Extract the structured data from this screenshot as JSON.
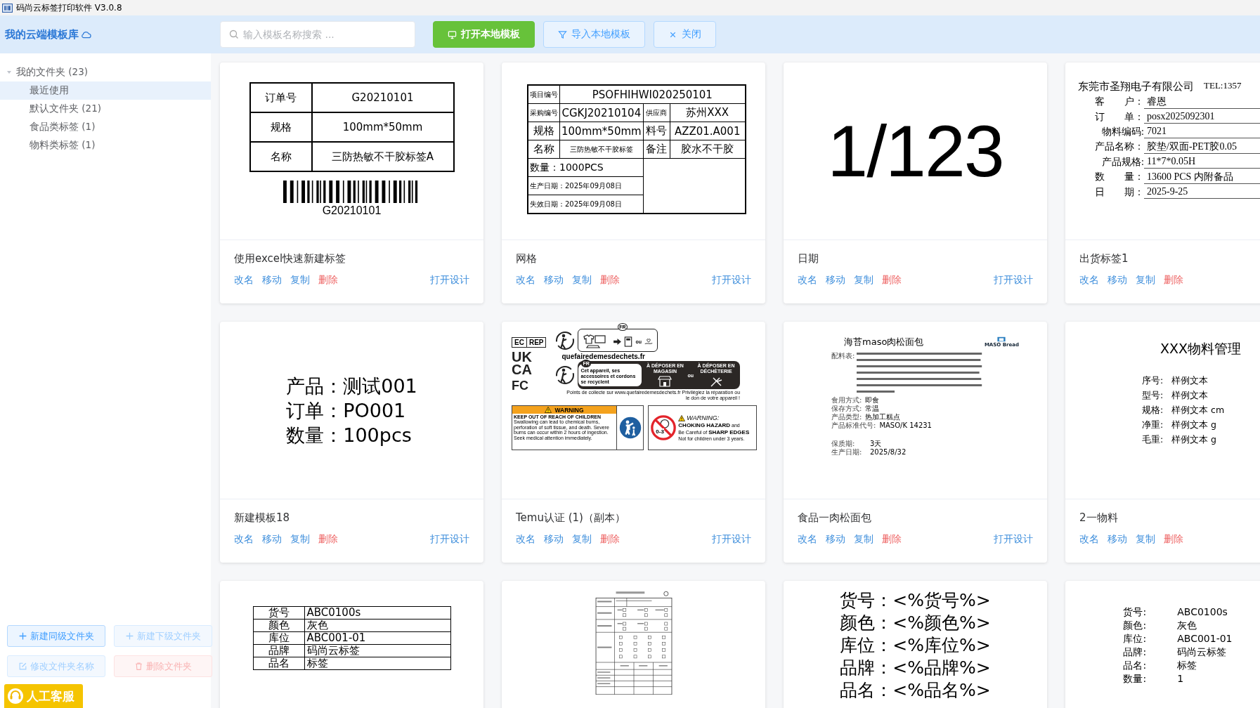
{
  "window": {
    "title": "码尚云标签打印软件 V3.0.8"
  },
  "library": {
    "title": "我的云端模板库"
  },
  "search": {
    "placeholder": "输入模板名称搜索 ..."
  },
  "toolbar": [
    {
      "label": "打开本地模板",
      "kind": "primary"
    },
    {
      "label": "导入本地模板",
      "kind": "plain"
    },
    {
      "label": "关闭",
      "kind": "plain"
    }
  ],
  "folders": [
    {
      "label": "我的文件夹 (23)",
      "expanded": true,
      "selected": false,
      "children": [
        {
          "label": "最近使用",
          "selected": true
        },
        {
          "label": "默认文件夹 (21)",
          "selected": false
        },
        {
          "label": "食品类标签 (1)",
          "selected": false
        },
        {
          "label": "物料类标签 (1)",
          "selected": false
        }
      ]
    }
  ],
  "sidebar_buttons": [
    {
      "label": "新建同级文件夹",
      "kind": "normal",
      "disabled": false
    },
    {
      "label": "新建下级文件夹",
      "kind": "normal",
      "disabled": true
    },
    {
      "label": "修改文件夹名称",
      "kind": "normal",
      "disabled": true
    },
    {
      "label": "删除文件夹",
      "kind": "danger",
      "disabled": true
    }
  ],
  "support": {
    "label": "人工客服"
  },
  "cards": [
    {
      "name": "使用excel快速新建标签",
      "open": "打开设计",
      "actions": [
        {
          "label": "改名",
          "kind": "normal"
        },
        {
          "label": "移动",
          "kind": "normal"
        },
        {
          "label": "复制",
          "kind": "normal"
        },
        {
          "label": "删除",
          "kind": "danger"
        }
      ],
      "preview": {
        "kind": "table",
        "rows": [
          [
            "订单号",
            "G20210101"
          ],
          [
            "规格",
            "100mm*50mm"
          ],
          [
            "名称",
            "三防热敏不干胶标签A"
          ]
        ],
        "barcode": "G20210101"
      }
    },
    {
      "name": "网格",
      "open": "打开设计",
      "actions": [
        {
          "label": "改名",
          "kind": "normal"
        },
        {
          "label": "移动",
          "kind": "normal"
        },
        {
          "label": "复制",
          "kind": "normal"
        },
        {
          "label": "删除",
          "kind": "danger"
        }
      ],
      "preview": {
        "kind": "grid",
        "rows": [
          [
            {
              "text": "项目编号"
            },
            {
              "text": "PSOFHIHWI020250101",
              "colspan": 3
            }
          ],
          [
            {
              "text": "采购编号"
            },
            {
              "text": "CGKJ20210104"
            },
            {
              "text": "供应商"
            },
            {
              "text": "苏州XXX"
            }
          ],
          [
            {
              "text": "规格"
            },
            {
              "text": "100mm*50mm"
            },
            {
              "text": "料号"
            },
            {
              "text": "AZZ01.A001"
            }
          ],
          [
            {
              "text": "名称"
            },
            {
              "text": "三防热敏不干胶标签"
            },
            {
              "text": "备注"
            },
            {
              "text": "胶水不干胶"
            }
          ]
        ],
        "lower": [
          "数量：1000PCS",
          "生产日期：2025年09月08日",
          "失效日期：2025年09月08日"
        ]
      }
    },
    {
      "name": "日期",
      "open": "打开设计",
      "actions": [
        {
          "label": "改名",
          "kind": "normal"
        },
        {
          "label": "移动",
          "kind": "normal"
        },
        {
          "label": "复制",
          "kind": "normal"
        },
        {
          "label": "删除",
          "kind": "danger"
        }
      ],
      "preview": {
        "kind": "big",
        "text": "1/123"
      }
    },
    {
      "name": "出货标签1",
      "actions": [
        {
          "label": "改名",
          "kind": "normal"
        },
        {
          "label": "移动",
          "kind": "normal"
        },
        {
          "label": "复制",
          "kind": "normal"
        },
        {
          "label": "删除",
          "kind": "danger"
        }
      ],
      "preview": {
        "kind": "form",
        "title": "东莞市圣翔电子有限公司",
        "tel": "TEL:1357",
        "fields": [
          [
            "客　　户：",
            "睿恩"
          ],
          [
            "订　　单：",
            "posx2025092301"
          ],
          [
            "物料编码:",
            "7021"
          ],
          [
            "产品名称：",
            "胶垫/双面-PET胶0.05"
          ],
          [
            "产品规格:",
            "11*7*0.05H"
          ],
          [
            "数　　量：",
            "13600 PCS 内附备品"
          ],
          [
            "日　　期：",
            "2025-9-25"
          ]
        ]
      }
    },
    {
      "name": "新建模板18",
      "open": "打开设计",
      "actions": [
        {
          "label": "改名",
          "kind": "normal"
        },
        {
          "label": "移动",
          "kind": "normal"
        },
        {
          "label": "复制",
          "kind": "normal"
        },
        {
          "label": "删除",
          "kind": "danger"
        }
      ],
      "preview": {
        "kind": "lines",
        "text": [
          "产品：测试001",
          "订单：PO001",
          "数量：100pcs"
        ]
      }
    },
    {
      "name": "Temu认证 (1)（副本）",
      "open": "打开设计",
      "actions": [
        {
          "label": "改名",
          "kind": "normal"
        },
        {
          "label": "移动",
          "kind": "normal"
        },
        {
          "label": "复制",
          "kind": "normal"
        },
        {
          "label": "删除",
          "kind": "danger"
        }
      ],
      "preview": {
        "kind": "temu",
        "ec": "EC",
        "rep": "REP",
        "uk": "UK",
        "ca": "CA",
        "fc": "FC",
        "fr": "FR",
        "fr2": "FR",
        "site": "quefairedemesdechets.fr",
        "ou": "ou",
        "ou2": "ou",
        "recycle": "Cet appareil, ses accessoires et cordons se recyclent",
        "deposit": [
          "À DÉPOSER EN MAGASIN",
          "À DÉPOSER EN DÉCHÈTERIE"
        ],
        "points": "Points de collecte sur www.quefairedemesdechets.fr Privilégiez la réparation ou le don de votre appareil !",
        "warn_title": "WARNING",
        "warn_head": "KEEP OUT OF REACH OF CHILDREN",
        "warn_body": "Swallowing can lead to chemical burns, perforation of soft tissue, and death. Severe burns can occur within 2 hours of ingestion. Seek medical attention immediately.",
        "age": "0-3",
        "warn2_title": "WARNING:",
        "warn2_lines": [
          "**CHOKING HAZARD** and",
          "Be Careful of **SHARP EDGES**",
          "Not for children under 3 years."
        ]
      }
    },
    {
      "name": "食品一肉松面包",
      "open": "打开设计",
      "actions": [
        {
          "label": "改名",
          "kind": "normal"
        },
        {
          "label": "移动",
          "kind": "normal"
        },
        {
          "label": "复制",
          "kind": "normal"
        },
        {
          "label": "删除",
          "kind": "danger"
        }
      ],
      "preview": {
        "kind": "food",
        "title": "海苔maso肉松面包",
        "brand": "MASO Bread",
        "ingredients_label": "配料表:",
        "fields": [
          [
            "食用方式:",
            "即食"
          ],
          [
            "保存方式:",
            "常温"
          ],
          [
            "产品类型:",
            "热加工糕点"
          ],
          [
            "产品标准代号:",
            "MASO/K 14231"
          ]
        ],
        "dates": [
          [
            "保质期:",
            "3天"
          ],
          [
            "生产日期:",
            "2025/8/32"
          ]
        ]
      }
    },
    {
      "name": "2一物料",
      "actions": [
        {
          "label": "改名",
          "kind": "normal"
        },
        {
          "label": "移动",
          "kind": "normal"
        },
        {
          "label": "复制",
          "kind": "normal"
        },
        {
          "label": "删除",
          "kind": "danger"
        }
      ],
      "preview": {
        "kind": "kv",
        "title": "XXX物料管理",
        "rows": [
          [
            "序号:",
            "样例文本"
          ],
          [
            "型号:",
            "样例文本"
          ],
          [
            "规格:",
            "样例文本 cm"
          ],
          [
            "净重:",
            "样例文本 g"
          ],
          [
            "毛重:",
            "样例文本 g"
          ]
        ]
      }
    },
    {
      "preview": {
        "kind": "compact-table",
        "rows": [
          [
            "货号",
            "ABC0100s"
          ],
          [
            "颜色",
            "灰色"
          ],
          [
            "库位",
            "ABC001-01"
          ],
          [
            "品牌",
            "码尚云标签"
          ],
          [
            "品名",
            "标签"
          ]
        ]
      }
    },
    {
      "preview": {
        "kind": "sheet"
      }
    },
    {
      "preview": {
        "kind": "lines",
        "text": [
          "货号：<%货号%>",
          "颜色：<%颜色%>",
          "库位：<%库位%>",
          "品牌：<%品牌%>",
          "品名：<%品名%>"
        ]
      }
    },
    {
      "preview": {
        "kind": "kv",
        "rows": [
          [
            "货号:",
            "ABC0100s"
          ],
          [
            "颜色:",
            "灰色"
          ],
          [
            "库位:",
            "ABC001-01"
          ],
          [
            "品牌:",
            "码尚云标签"
          ],
          [
            "品名:",
            "标签"
          ],
          [
            "数量:",
            "1"
          ]
        ]
      }
    }
  ]
}
